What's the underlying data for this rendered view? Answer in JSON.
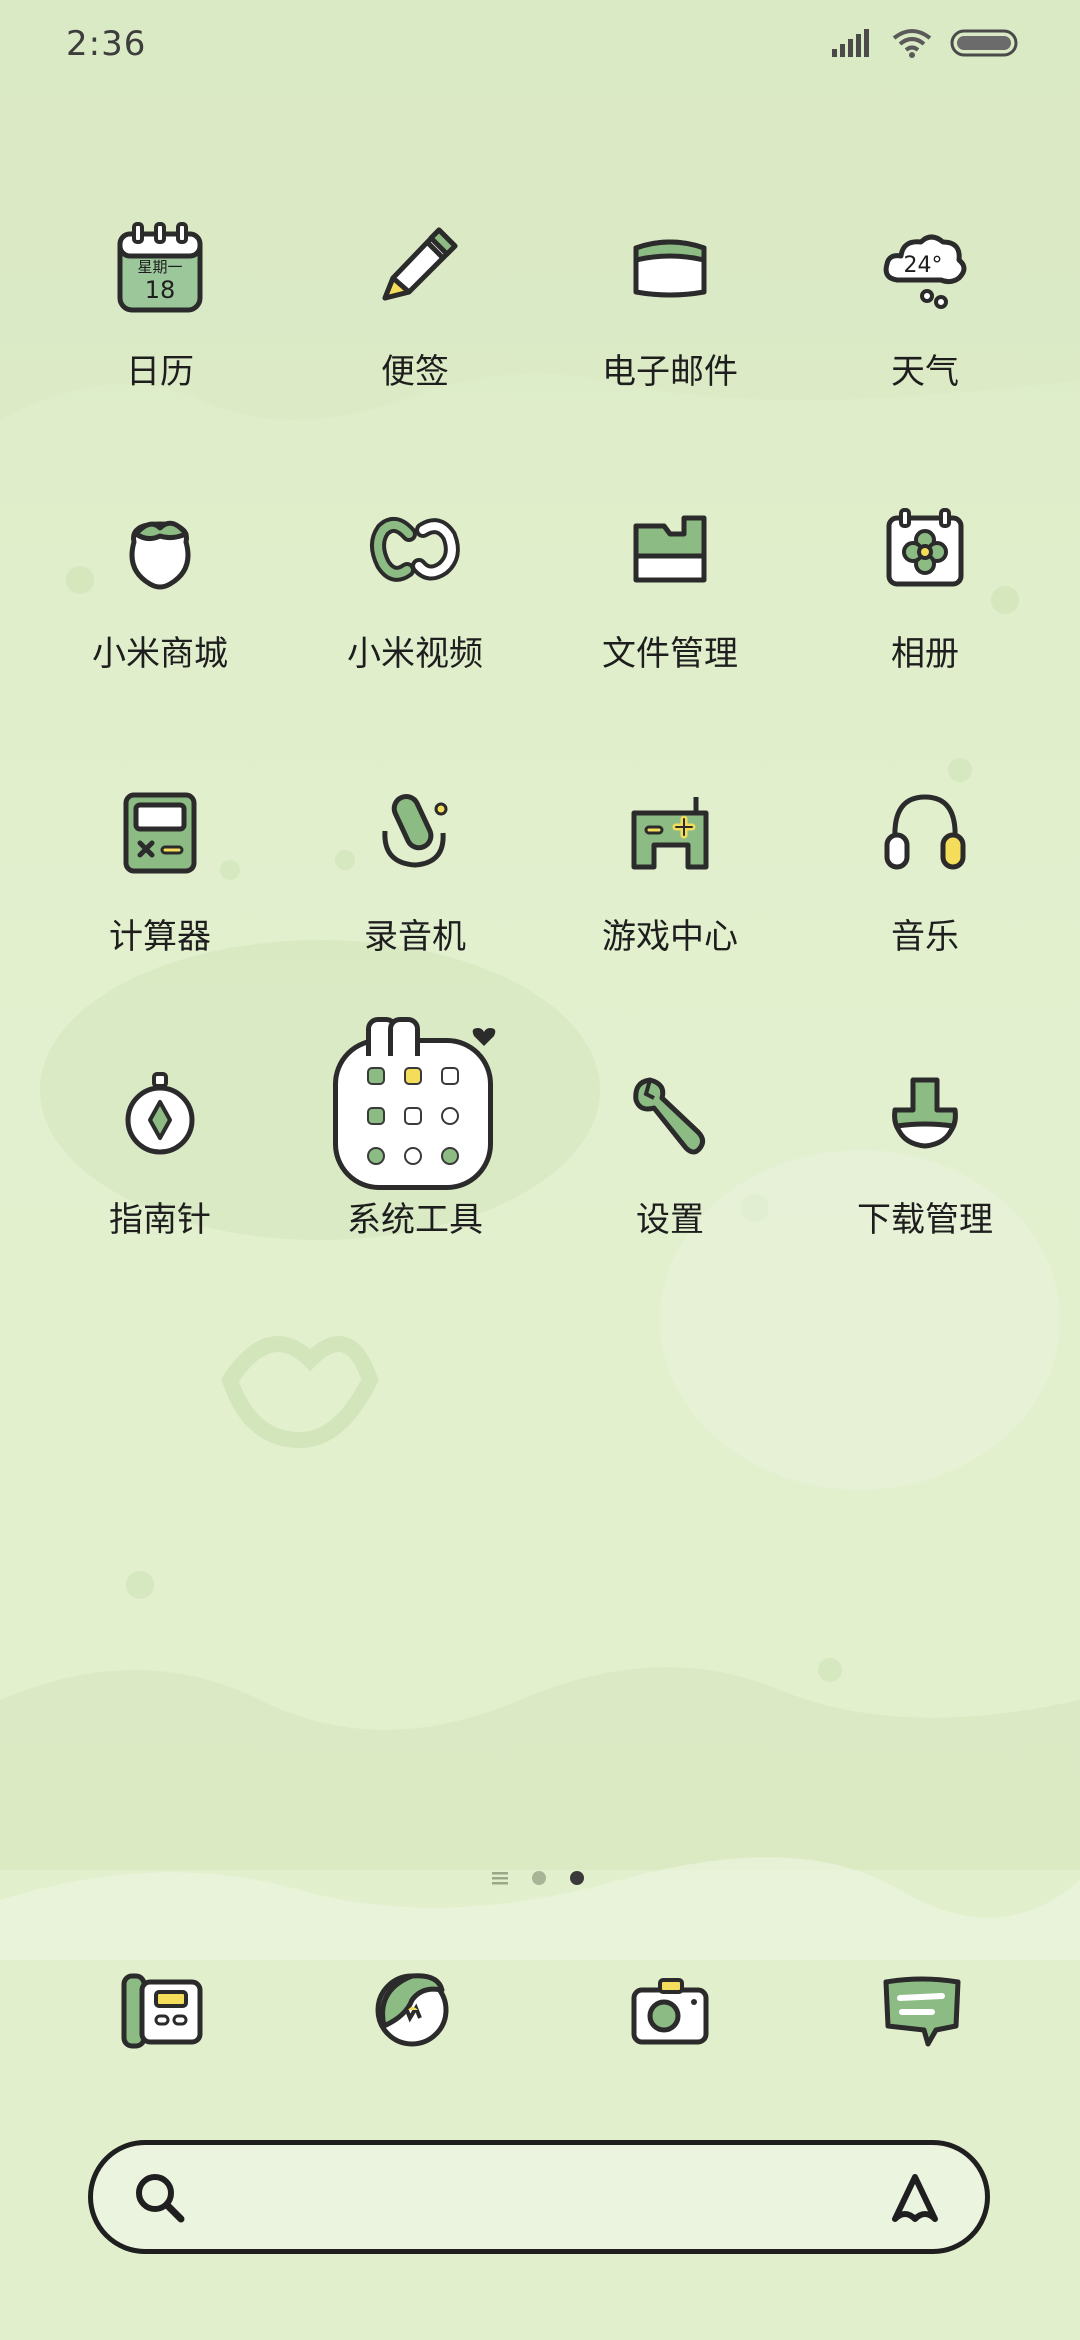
{
  "status_bar": {
    "time": "2:36"
  },
  "apps": [
    {
      "label": "日历",
      "icon": "calendar-icon",
      "day_text": "星期一",
      "date_text": "18"
    },
    {
      "label": "便签",
      "icon": "notes-icon"
    },
    {
      "label": "电子邮件",
      "icon": "email-icon"
    },
    {
      "label": "天气",
      "icon": "weather-icon",
      "temp_text": "24°"
    },
    {
      "label": "小米商城",
      "icon": "store-icon"
    },
    {
      "label": "小米视频",
      "icon": "video-icon"
    },
    {
      "label": "文件管理",
      "icon": "file-manager-icon"
    },
    {
      "label": "相册",
      "icon": "gallery-icon"
    },
    {
      "label": "计算器",
      "icon": "calculator-icon"
    },
    {
      "label": "录音机",
      "icon": "recorder-icon"
    },
    {
      "label": "游戏中心",
      "icon": "game-center-icon"
    },
    {
      "label": "音乐",
      "icon": "music-icon"
    },
    {
      "label": "指南针",
      "icon": "compass-icon"
    },
    {
      "label": "系统工具",
      "icon": "folder-icon"
    },
    {
      "label": "设置",
      "icon": "settings-icon"
    },
    {
      "label": "下载管理",
      "icon": "download-icon"
    }
  ],
  "dock": [
    {
      "icon": "phone-icon"
    },
    {
      "icon": "browser-icon"
    },
    {
      "icon": "camera-icon"
    },
    {
      "icon": "messages-icon"
    }
  ],
  "pager": {
    "pages": 3,
    "current": 3
  },
  "colors": {
    "accent_green": "#8dbb84",
    "dark_stroke": "#2b2b2b",
    "yellow": "#f3dd5a"
  }
}
